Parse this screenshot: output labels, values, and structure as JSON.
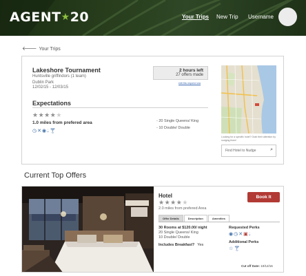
{
  "header": {
    "logo_text": "AGENT",
    "logo_number": "20",
    "nav": [
      {
        "label": "Your Trips",
        "active": true
      },
      {
        "label": "New Trip",
        "active": false
      },
      {
        "label": "Username",
        "active": false
      }
    ]
  },
  "back_link": "Your Trips",
  "trip": {
    "title": "Lakeshore Tournament",
    "subtitle": "Huntsville griffindors (1 team)",
    "location": "Dublin Park",
    "dates": "12/02/15 - 12/03/15",
    "time_left": "2 hours left",
    "offers_made": "27 offers made",
    "edit_link": "edit this request now",
    "expectations_title": "Expectations",
    "star_rating": 4,
    "star_max": 5,
    "distance": "1.0 miles from prefered area",
    "rooms": [
      "- 20 Single Queens/ King",
      "- 10 Double/ Double"
    ],
    "perk_icons": [
      "clock-icon",
      "utensils-icon",
      "bus-icon",
      "drop-icon",
      "cocktail-icon"
    ],
    "map_hint": "Looking for a specific hotel? Grab their attention by nudging them!",
    "nudge_placeholder": "Find Hotel to Nudge"
  },
  "section_title": "Current Top Offers",
  "offer": {
    "name": "Hotel",
    "star_rating": 4,
    "star_max": 5,
    "distance": "2.0 miles from prefered Area",
    "book_label": "Book It",
    "tabs": [
      "Offer Details",
      "Description",
      "Amenities"
    ],
    "active_tab": 0,
    "rooms_price": "30 Rooms at $120.00/ night",
    "room_lines": [
      "20 Single Queens/ King",
      "10 Double/ Double"
    ],
    "breakfast_label": "Includes Breakfast?",
    "breakfast_value": "Yes",
    "requested_perks_label": "Requested Perks",
    "requested_perk_icons": [
      "bus-icon",
      "clock-icon",
      "utensils-icon",
      "award-icon",
      "drop-icon"
    ],
    "additional_perks_label": "Additional Perks",
    "additional_perk_icons": [
      "star-icon",
      "cocktail-icon"
    ],
    "cutoff_label": "Cut off Date:",
    "cutoff_date": "10/12/16"
  },
  "colors": {
    "header_bg": "#243a1a",
    "logo_accent": "#8cbf3f",
    "book_button": "#b23a34",
    "icon_blue": "#3f6fa8"
  }
}
